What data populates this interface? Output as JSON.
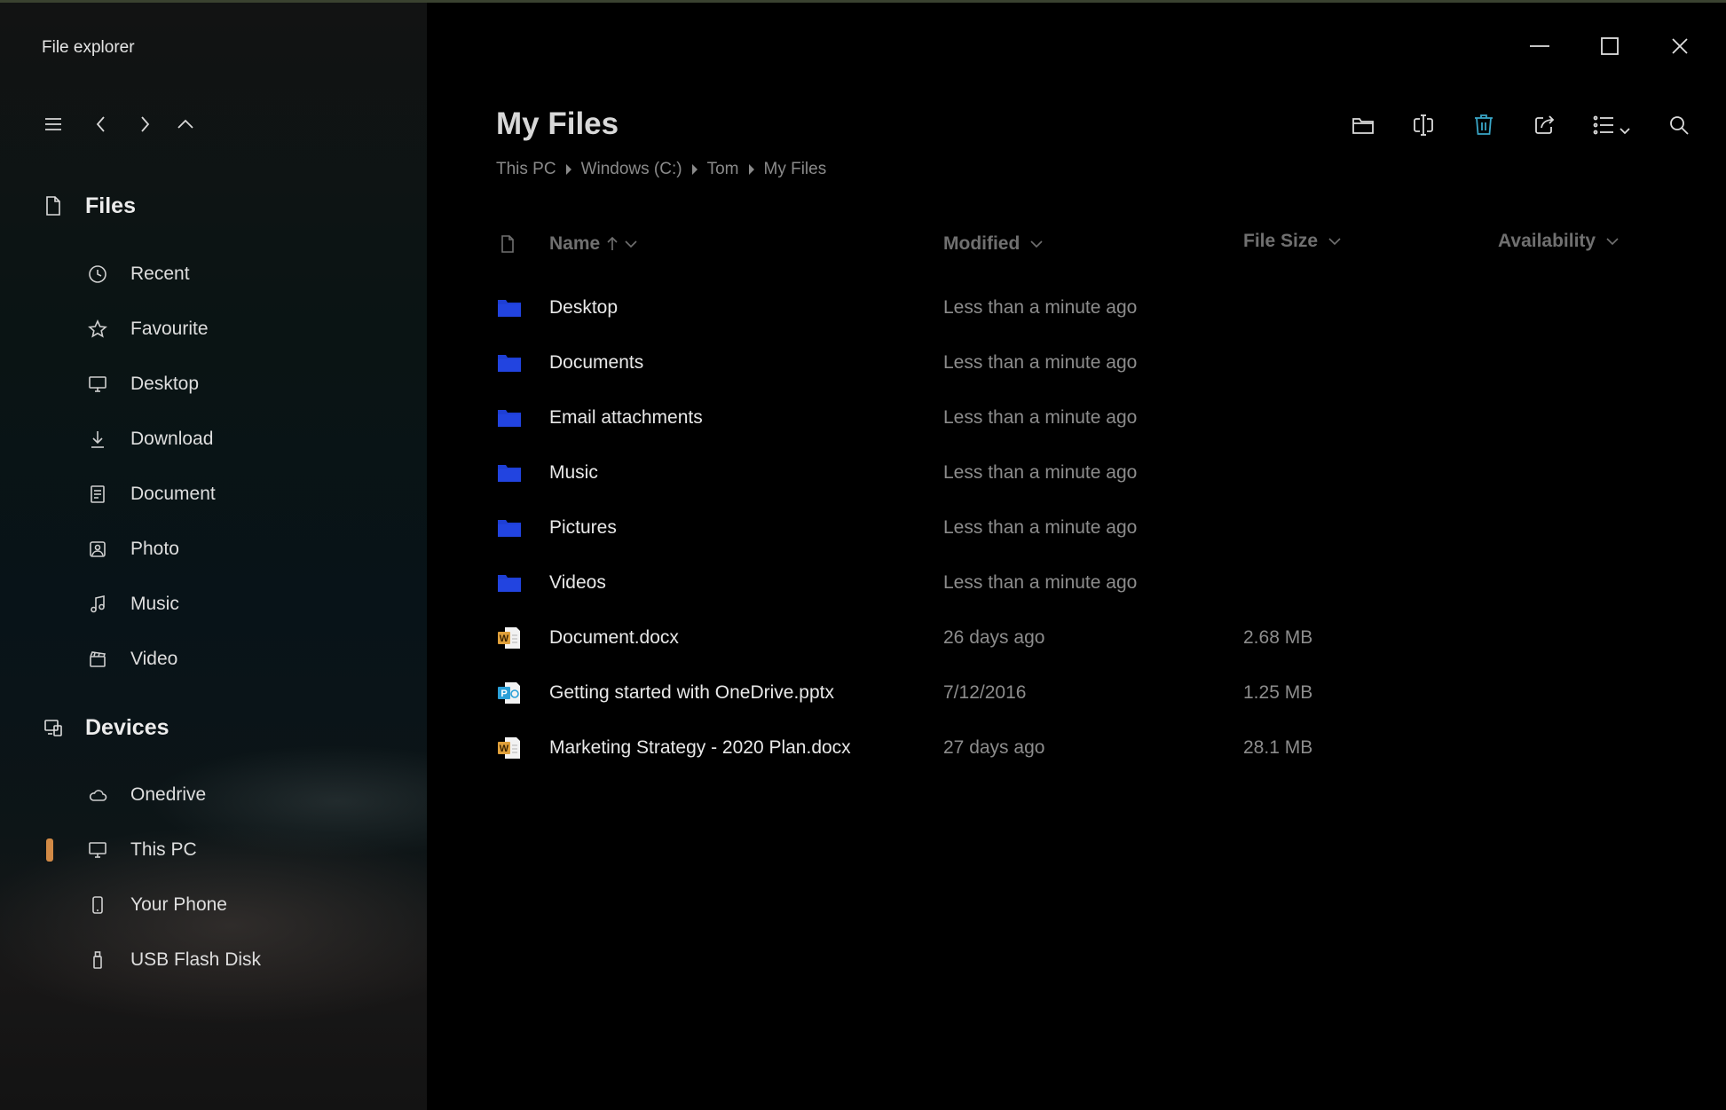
{
  "app": {
    "title": "File explorer"
  },
  "sidebar": {
    "files_heading": "Files",
    "files_items": [
      {
        "label": "Recent",
        "icon": "clock-icon"
      },
      {
        "label": "Favourite",
        "icon": "star-icon"
      },
      {
        "label": "Desktop",
        "icon": "monitor-icon"
      },
      {
        "label": "Download",
        "icon": "download-icon"
      },
      {
        "label": "Document",
        "icon": "document-icon"
      },
      {
        "label": "Photo",
        "icon": "photo-icon"
      },
      {
        "label": "Music",
        "icon": "music-icon"
      },
      {
        "label": "Video",
        "icon": "video-icon"
      }
    ],
    "devices_heading": "Devices",
    "devices_items": [
      {
        "label": "Onedrive",
        "icon": "cloud-icon"
      },
      {
        "label": "This PC",
        "icon": "monitor-icon",
        "active": true
      },
      {
        "label": "Your Phone",
        "icon": "phone-icon"
      },
      {
        "label": "USB Flash Disk",
        "icon": "usb-icon"
      }
    ],
    "accent_color": "#d28a46"
  },
  "main": {
    "title": "My Files",
    "breadcrumb": [
      "This PC",
      "Windows (C:)",
      "Tom",
      "My Files"
    ],
    "toolbar": [
      "new-folder-icon",
      "rename-icon",
      "delete-icon",
      "share-icon",
      "view-list-icon",
      "search-icon"
    ],
    "columns": {
      "name": "Name",
      "modified": "Modified",
      "size": "File Size",
      "availability": "Availability"
    },
    "rows": [
      {
        "type": "folder",
        "name": "Desktop",
        "modified": "Less than a minute ago",
        "size": ""
      },
      {
        "type": "folder",
        "name": "Documents",
        "modified": "Less than a minute ago",
        "size": ""
      },
      {
        "type": "folder",
        "name": "Email attachments",
        "modified": "Less than a minute ago",
        "size": ""
      },
      {
        "type": "folder",
        "name": "Music",
        "modified": "Less than a minute ago",
        "size": ""
      },
      {
        "type": "folder",
        "name": "Pictures",
        "modified": "Less than a minute ago",
        "size": ""
      },
      {
        "type": "folder",
        "name": "Videos",
        "modified": "Less than a minute ago",
        "size": ""
      },
      {
        "type": "word",
        "name": "Document.docx",
        "modified": "26 days ago",
        "size": "2.68 MB"
      },
      {
        "type": "powerpoint",
        "name": "Getting started with OneDrive.pptx",
        "modified": "7/12/2016",
        "size": "1.25 MB"
      },
      {
        "type": "word",
        "name": "Marketing Strategy - 2020 Plan.docx",
        "modified": "27 days ago",
        "size": "28.1 MB"
      }
    ]
  },
  "colors": {
    "delete_icon": "#3aa7c8",
    "folder": "#1e3fd6",
    "word": "#e0a03a",
    "powerpoint": "#2aa0d8"
  }
}
